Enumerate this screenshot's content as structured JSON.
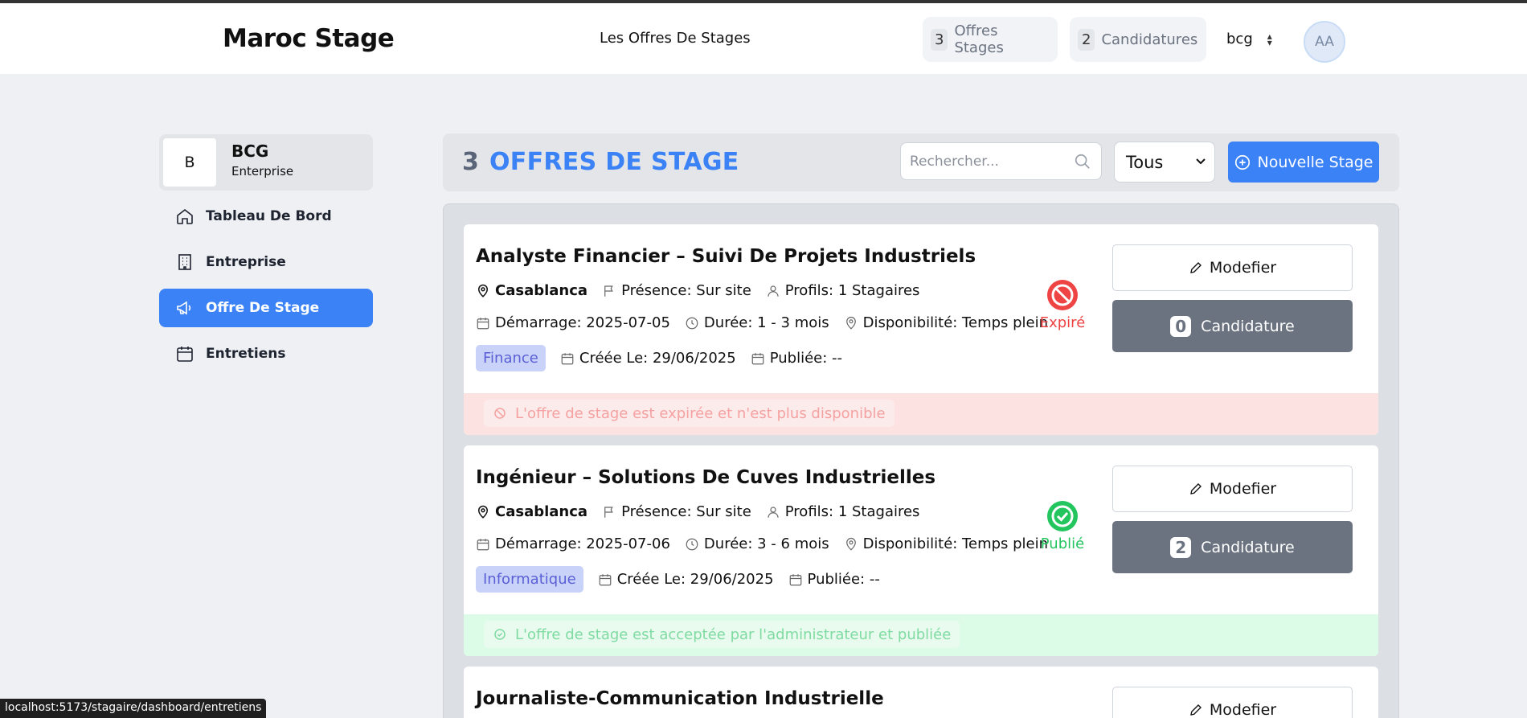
{
  "header": {
    "brand": "Maroc Stage",
    "nav_link": "Les Offres De Stages",
    "offres_count": "3",
    "offres_label": "Offres Stages",
    "cand_count": "2",
    "cand_label": "Candidatures",
    "user_select": "bcg",
    "avatar_initials": "AA"
  },
  "sidebar": {
    "company_initial": "B",
    "company_name": "BCG",
    "company_type": "Enterprise",
    "items": [
      {
        "label": "Tableau De Bord",
        "icon": "home-icon"
      },
      {
        "label": "Entreprise",
        "icon": "building-icon"
      },
      {
        "label": "Offre De Stage",
        "icon": "megaphone-icon",
        "active": true
      },
      {
        "label": "Entretiens",
        "icon": "calendar-icon"
      }
    ]
  },
  "list": {
    "count": "3",
    "title": "OFFRES DE STAGE",
    "search_placeholder": "Rechercher...",
    "filter_value": "Tous",
    "new_button": "Nouvelle Stage"
  },
  "offers": [
    {
      "title": "Analyste Financier – Suivi De Projets Industriels",
      "city": "Casablanca",
      "presence": "Présence: Sur site",
      "profils": "Profils: 1 Stagaires",
      "start": "Démarrage: 2025-07-05",
      "duree": "Durée: 1 - 3 mois",
      "dispo": "Disponibilité: Temps plein",
      "tag": "Finance",
      "created": "Créée Le: 29/06/2025",
      "published": "Publiée: --",
      "status": "Expiré",
      "modify": "Modefier",
      "cand_count": "0",
      "cand_label": "Candidature",
      "notice": "L'offre de stage est expirée et n'est plus disponible"
    },
    {
      "title": "Ingénieur – Solutions De Cuves Industrielles",
      "city": "Casablanca",
      "presence": "Présence: Sur site",
      "profils": "Profils: 1 Stagaires",
      "start": "Démarrage: 2025-07-06",
      "duree": "Durée: 3 - 6 mois",
      "dispo": "Disponibilité: Temps plein",
      "tag": "Informatique",
      "created": "Créée Le: 29/06/2025",
      "published": "Publiée: --",
      "status": "Publié",
      "modify": "Modefier",
      "cand_count": "2",
      "cand_label": "Candidature",
      "notice": "L'offre de stage est acceptée par l'administrateur et publiée"
    },
    {
      "title": "Journaliste-Communication Industrielle",
      "modify": "Modefier"
    }
  ],
  "status_bar_url": "localhost:5173/stagaire/dashboard/entretiens",
  "colors": {
    "accent": "#3b82f6",
    "expired": "#ef4444",
    "published": "#22c55e",
    "button_gray": "#6b7280"
  }
}
